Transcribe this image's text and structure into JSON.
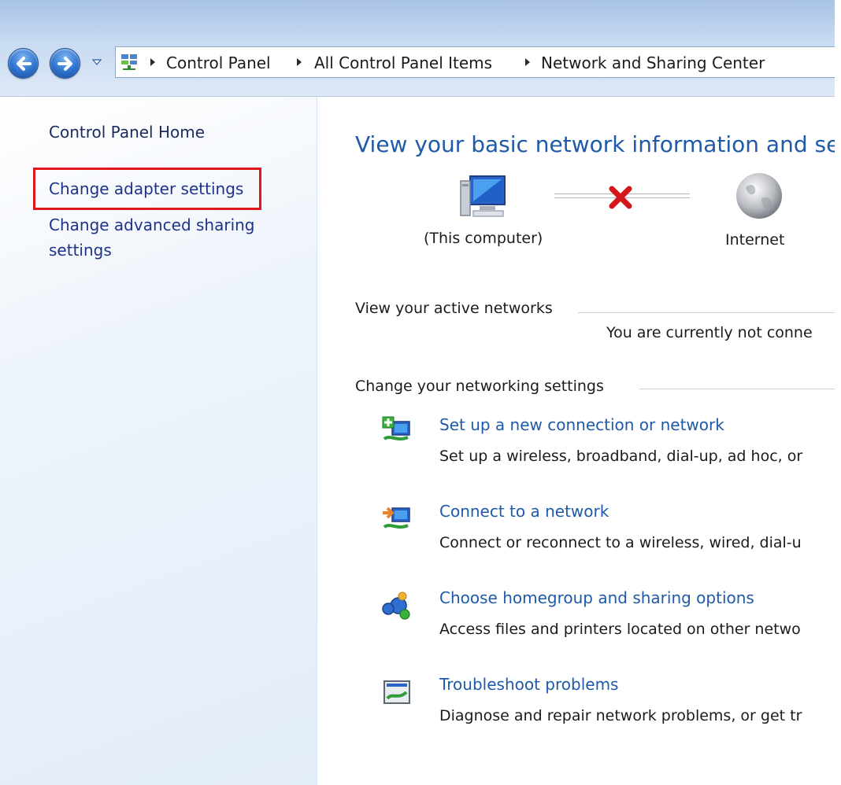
{
  "address_bar": {
    "breadcrumbs": [
      "Control Panel",
      "All Control Panel Items",
      "Network and Sharing Center"
    ],
    "icon": "control-panel-icon"
  },
  "nav": {
    "back_icon": "back-arrow-icon",
    "forward_icon": "forward-arrow-icon",
    "history_icon": "chevron-down-icon"
  },
  "sidebar": {
    "items": [
      {
        "label": "Control Panel Home"
      },
      {
        "label": "Change adapter settings",
        "highlighted": true
      },
      {
        "label": "Change advanced sharing settings",
        "line1": "Change advanced sharing",
        "line2": "settings"
      }
    ],
    "highlight_color": "#e0161c"
  },
  "main": {
    "title": "View your basic network information and se",
    "network_map": {
      "computer_label": "(This computer)",
      "internet_label": "Internet",
      "status_icon": "red-x-icon"
    },
    "active_networks": {
      "heading": "View your active networks",
      "status": "You are currently not conne"
    },
    "settings": {
      "heading": "Change your networking settings",
      "tasks": [
        {
          "icon": "new-connection-icon",
          "label": "Set up a new connection or network",
          "desc": "Set up a wireless, broadband, dial-up, ad hoc, or"
        },
        {
          "icon": "connect-network-icon",
          "label": "Connect to a network",
          "desc": "Connect or reconnect to a wireless, wired, dial-u"
        },
        {
          "icon": "homegroup-icon",
          "label": "Choose homegroup and sharing options",
          "desc": "Access files and printers located on other netwo"
        },
        {
          "icon": "troubleshoot-icon",
          "label": "Troubleshoot problems",
          "desc": "Diagnose and repair network problems, or get tr"
        }
      ]
    }
  },
  "colors": {
    "link": "#1e5aa8",
    "sidebar_link": "#1e3287",
    "title": "#1e5aa8"
  }
}
